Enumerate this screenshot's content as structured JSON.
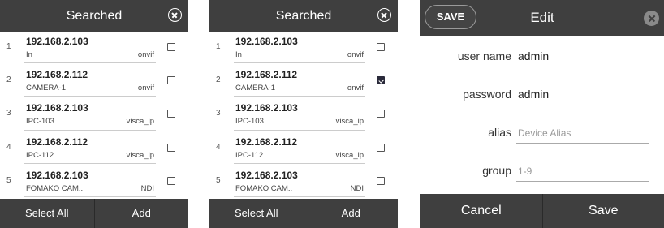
{
  "panel1": {
    "title": "Searched",
    "rows": [
      {
        "index": "1",
        "ip": "192.168.2.103",
        "name": "In",
        "protocol": "onvif",
        "checked": false
      },
      {
        "index": "2",
        "ip": "192.168.2.112",
        "name": "CAMERA-1",
        "protocol": "onvif",
        "checked": false
      },
      {
        "index": "3",
        "ip": "192.168.2.103",
        "name": "IPC-103",
        "protocol": "visca_ip",
        "checked": false
      },
      {
        "index": "4",
        "ip": "192.168.2.112",
        "name": "IPC-112",
        "protocol": "visca_ip",
        "checked": false
      },
      {
        "index": "5",
        "ip": "192.168.2.103",
        "name": "FOMAKO CAM..",
        "protocol": "NDI",
        "checked": false
      }
    ],
    "select_all_label": "Select All",
    "add_label": "Add"
  },
  "panel2": {
    "title": "Searched",
    "rows": [
      {
        "index": "1",
        "ip": "192.168.2.103",
        "name": "In",
        "protocol": "onvif",
        "checked": false
      },
      {
        "index": "2",
        "ip": "192.168.2.112",
        "name": "CAMERA-1",
        "protocol": "onvif",
        "checked": true
      },
      {
        "index": "3",
        "ip": "192.168.2.103",
        "name": "IPC-103",
        "protocol": "visca_ip",
        "checked": false
      },
      {
        "index": "4",
        "ip": "192.168.2.112",
        "name": "IPC-112",
        "protocol": "visca_ip",
        "checked": false
      },
      {
        "index": "5",
        "ip": "192.168.2.103",
        "name": "FOMAKO CAM..",
        "protocol": "NDI",
        "checked": false
      }
    ],
    "select_all_label": "Select All",
    "add_label": "Add"
  },
  "edit": {
    "save_pill_label": "SAVE",
    "title": "Edit",
    "fields": {
      "user_name": {
        "label": "user name",
        "value": "admin"
      },
      "password": {
        "label": "password",
        "value": "admin"
      },
      "alias": {
        "label": "alias",
        "placeholder": "Device Alias"
      },
      "group": {
        "label": "group",
        "placeholder": "1-9"
      }
    },
    "cancel_label": "Cancel",
    "save_label": "Save"
  },
  "icons": {
    "close": "close-icon",
    "checkbox": "checkbox-icon"
  },
  "colors": {
    "header_bg": "#3f3f3f",
    "checked_bg": "#2a2a3a"
  }
}
